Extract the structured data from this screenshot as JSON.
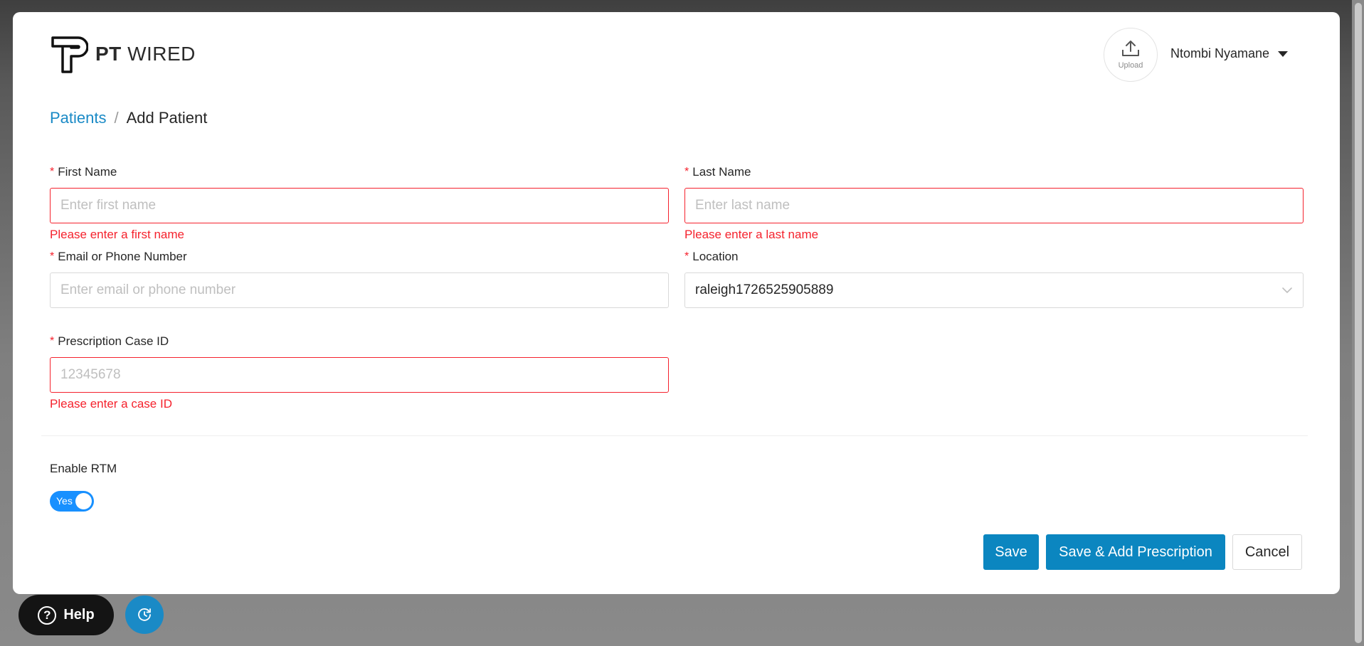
{
  "brand": {
    "bold": "PT",
    "light": "WIRED"
  },
  "header": {
    "upload_label": "Upload",
    "user_name": "Ntombi Nyamane"
  },
  "breadcrumb": {
    "parent": "Patients",
    "separator": "/",
    "current": "Add Patient"
  },
  "form": {
    "first_name": {
      "label": "First Name",
      "value": "",
      "placeholder": "Enter first name",
      "error": "Please enter a first name"
    },
    "last_name": {
      "label": "Last Name",
      "value": "",
      "placeholder": "Enter last name",
      "error": "Please enter a last name"
    },
    "contact": {
      "label": "Email or Phone Number",
      "value": "",
      "placeholder": "Enter email or phone number"
    },
    "location": {
      "label": "Location",
      "value": "raleigh1726525905889"
    },
    "case_id": {
      "label": "Prescription Case ID",
      "value": "",
      "placeholder": "12345678",
      "error": "Please enter a case ID"
    },
    "required_marker": "*"
  },
  "rtm": {
    "label": "Enable RTM",
    "toggle_text": "Yes",
    "enabled": true
  },
  "actions": {
    "save": "Save",
    "save_add": "Save & Add Prescription",
    "cancel": "Cancel"
  },
  "floating": {
    "help_label": "Help",
    "help_glyph": "?"
  },
  "icons": [
    "logo-icon",
    "upload-icon",
    "caret-down-icon",
    "chevron-down-icon",
    "question-icon",
    "history-icon"
  ],
  "colors": {
    "accent": "#1a8ac6",
    "primary_button": "#0b86c0",
    "error": "#f5222d",
    "toggle": "#1890ff"
  }
}
